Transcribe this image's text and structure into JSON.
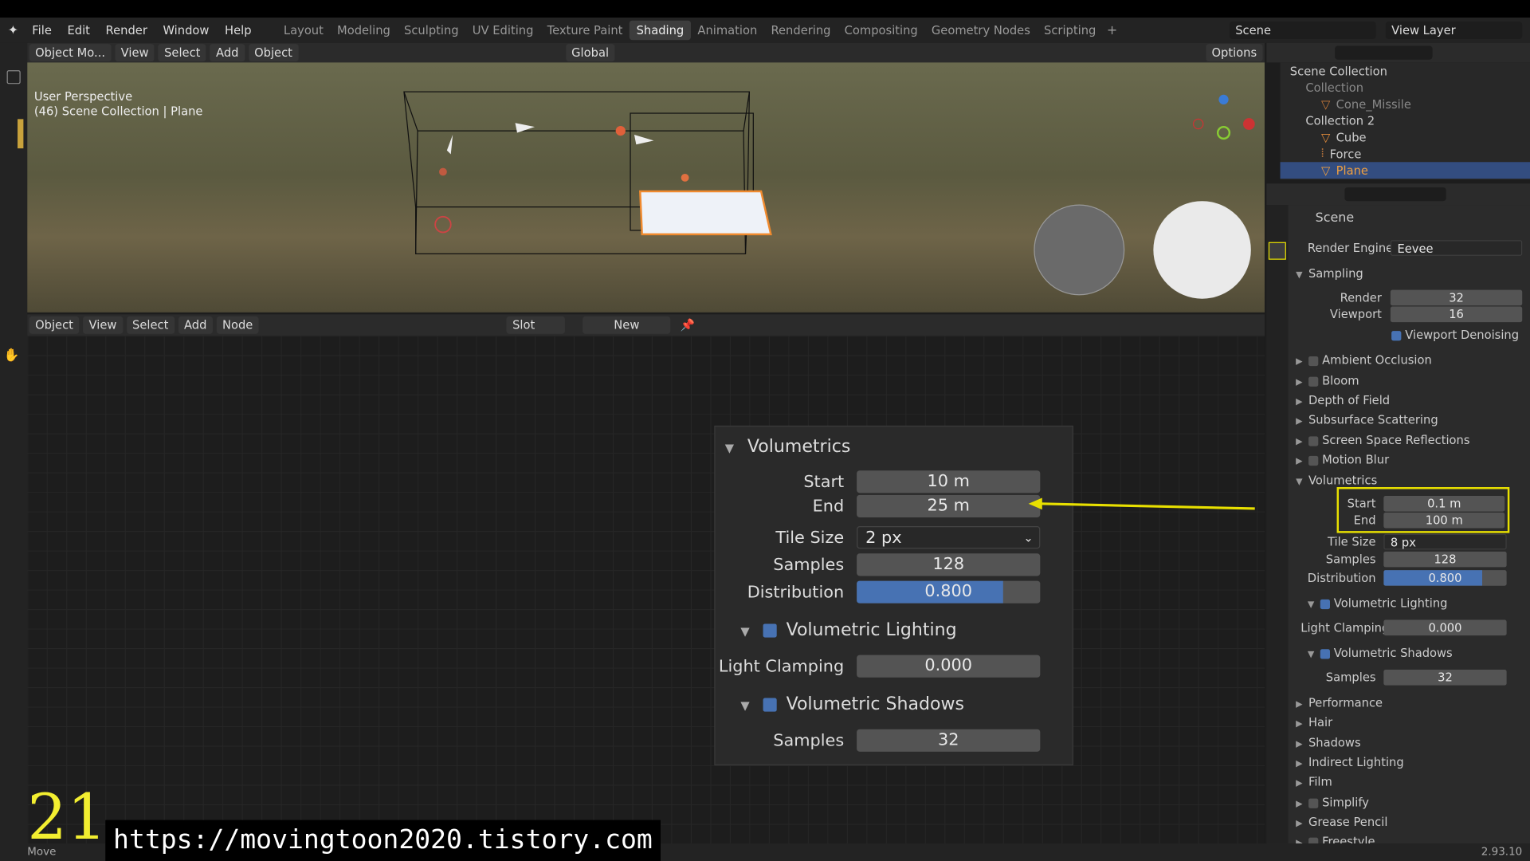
{
  "menu": [
    "File",
    "Edit",
    "Render",
    "Window",
    "Help"
  ],
  "workspaces": [
    "Layout",
    "Modeling",
    "Sculpting",
    "UV Editing",
    "Texture Paint",
    "Shading",
    "Animation",
    "Rendering",
    "Compositing",
    "Geometry Nodes",
    "Scripting"
  ],
  "active_workspace": "Shading",
  "scene_name": "Scene",
  "view_layer": "View Layer",
  "viewport": {
    "mode": "Object Mo...",
    "menus": [
      "View",
      "Select",
      "Add",
      "Object"
    ],
    "orientation": "Global",
    "options": "Options",
    "perspective": "User Perspective",
    "info": "(46) Scene Collection | Plane"
  },
  "node_editor": {
    "mode": "Object",
    "menus": [
      "View",
      "Select",
      "Add",
      "Node"
    ],
    "slot": "Slot",
    "new_label": "New"
  },
  "zoom_panel": {
    "title": "Volumetrics",
    "start_label": "Start",
    "start": "10 m",
    "end_label": "End",
    "end": "25 m",
    "tile_size_label": "Tile Size",
    "tile_size": "2 px",
    "samples_label": "Samples",
    "samples": "128",
    "distribution_label": "Distribution",
    "distribution": "0.800",
    "distribution_fraction": 0.8,
    "volumetric_lighting": "Volumetric Lighting",
    "light_clamping_label": "Light Clamping",
    "light_clamping": "0.000",
    "volumetric_shadows": "Volumetric Shadows",
    "shadow_samples_label": "Samples",
    "shadow_samples": "32"
  },
  "outliner": {
    "root": "Scene Collection",
    "items": [
      {
        "name": "Collection"
      },
      {
        "name": "Cone_Missile"
      },
      {
        "name": "Collection 2"
      },
      {
        "name": "Cube"
      },
      {
        "name": "Force"
      },
      {
        "name": "Plane"
      }
    ]
  },
  "properties": {
    "header": "Scene",
    "render_engine_label": "Render Engine",
    "render_engine": "Eevee",
    "sampling": "Sampling",
    "render_label": "Render",
    "render": "32",
    "viewport_label": "Viewport",
    "viewport": "16",
    "viewport_denoising": "Viewport Denoising",
    "sections": [
      "Ambient Occlusion",
      "Bloom",
      "Depth of Field",
      "Subsurface Scattering",
      "Screen Space Reflections",
      "Motion Blur"
    ],
    "volumetrics": "Volumetrics",
    "start_label": "Start",
    "start": "0.1 m",
    "end_label": "End",
    "end": "100 m",
    "tile_size_label": "Tile Size",
    "tile_size": "8 px",
    "samples_label": "Samples",
    "samples": "128",
    "distribution_label": "Distribution",
    "distribution": "0.800",
    "distribution_fraction": 0.8,
    "volumetric_lighting": "Volumetric Lighting",
    "light_clamping_label": "Light Clamping",
    "light_clamping": "0.000",
    "volumetric_shadows": "Volumetric Shadows",
    "shadow_samples_label": "Samples",
    "shadow_samples": "32",
    "more_sections": [
      "Performance",
      "Hair",
      "Shadows",
      "Indirect Lighting",
      "Film",
      "Simplify",
      "Grease Pencil",
      "Freestyle"
    ]
  },
  "overlay": {
    "number": "21",
    "url": "https://movingtoon2020.tistory.com"
  },
  "status": {
    "left": "Move",
    "version": "2.93.10"
  },
  "colors": {
    "accent": "#4772b3",
    "highlight": "#e8e000",
    "selected_row": "#334d80",
    "orange": "#f08a2e"
  }
}
